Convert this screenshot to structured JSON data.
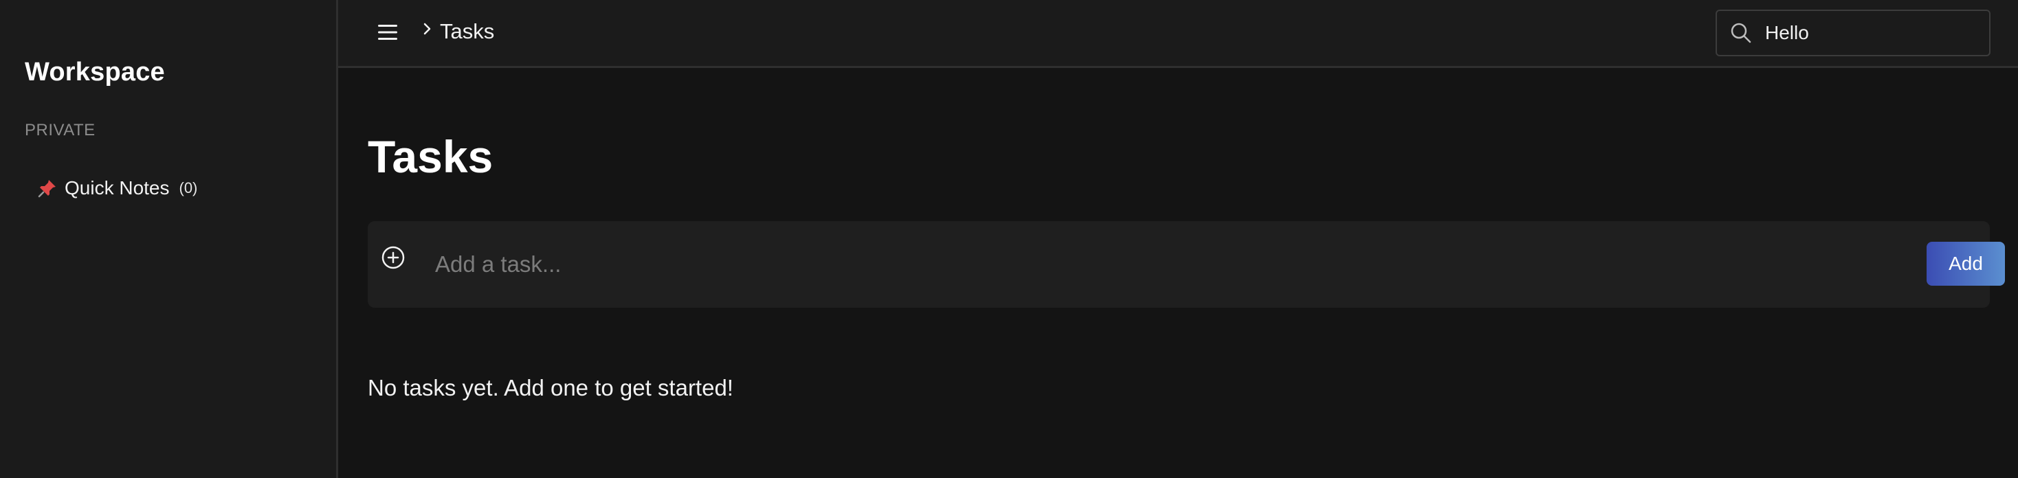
{
  "sidebar": {
    "title": "Workspace",
    "section_label": "PRIVATE",
    "items": [
      {
        "icon": "pin-icon",
        "label": "Quick Notes",
        "count": "(0)"
      }
    ]
  },
  "topbar": {
    "menu_icon": "hamburger-menu-icon",
    "breadcrumb_icon": "chevron-right-icon",
    "breadcrumb_label": "Tasks",
    "search": {
      "icon": "search-icon",
      "value": "Hello"
    }
  },
  "main": {
    "title": "Tasks",
    "add_task": {
      "icon": "plus-circle-icon",
      "placeholder": "Add a task...",
      "button_label": "Add"
    },
    "empty_message": "No tasks yet. Add one to get started!"
  },
  "colors": {
    "background": "#141414",
    "panel": "#1b1b1b",
    "accent_start": "#3b4db3",
    "accent_end": "#5b8fd0",
    "pin": "#e04848"
  }
}
